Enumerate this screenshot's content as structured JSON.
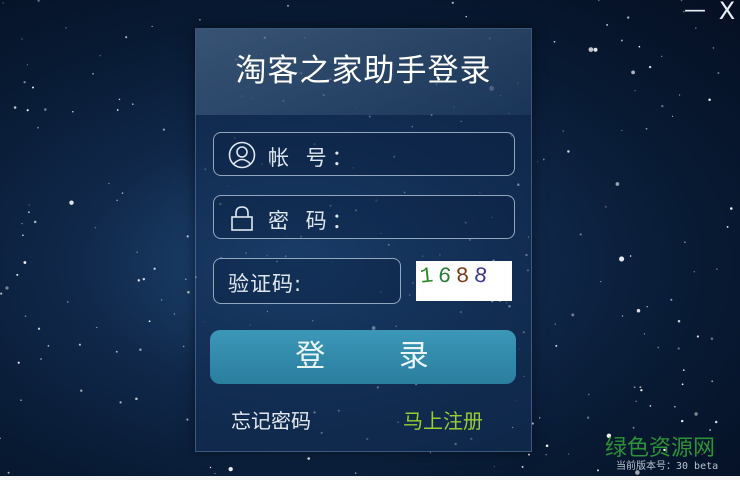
{
  "window": {
    "minimize_label": "—",
    "close_label": "X"
  },
  "login": {
    "title": "淘客之家助手登录",
    "account_label": "帐 号：",
    "password_label": "密 码：",
    "captcha_label": "验证码:",
    "captcha_code": [
      "1",
      "6",
      "8",
      "8"
    ],
    "captcha_colors": [
      "#2a8a2a",
      "#2a7a3a",
      "#7a3a1a",
      "#3a3a8a"
    ],
    "login_label": "登 录",
    "forgot_label": "忘记密码",
    "register_label": "马上注册"
  },
  "footer": {
    "watermark": "绿色资源网",
    "version": "当前版本号：30 beta"
  },
  "colors": {
    "login_button": "#3391b3",
    "register_link": "#9acd32"
  }
}
